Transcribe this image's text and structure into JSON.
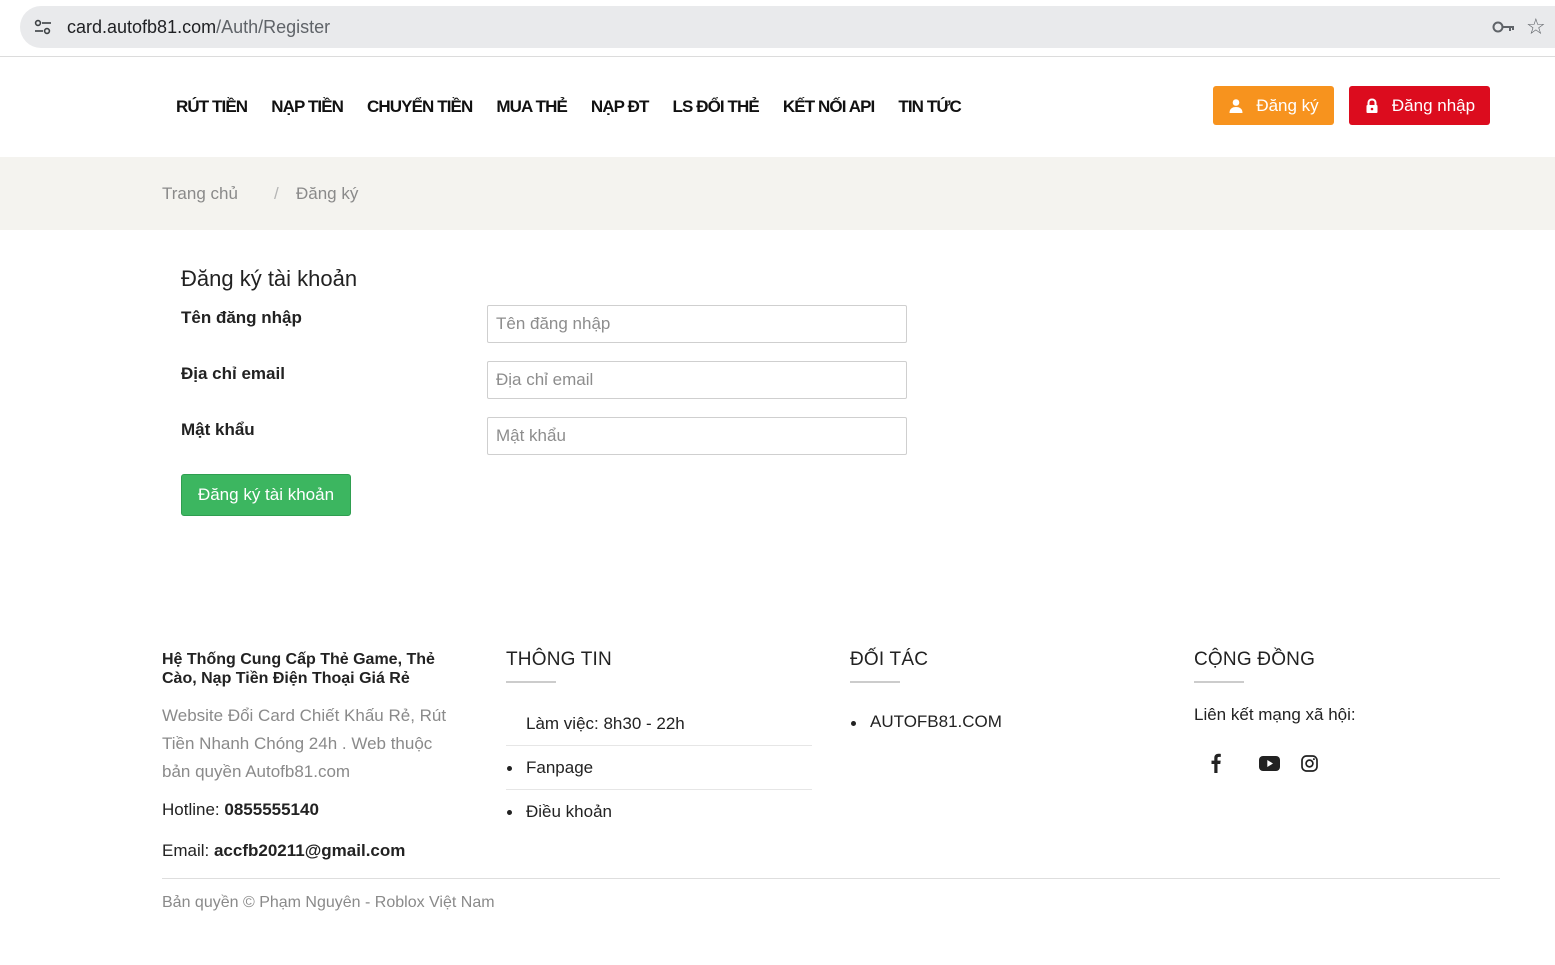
{
  "browser": {
    "url_host": "card.autofb81.com",
    "url_path": "/Auth/Register",
    "site_info_icon": "tune-icon",
    "password_icon": "key-icon",
    "bookmark_icon": "star-icon"
  },
  "header": {
    "nav": [
      "RÚT TIỀN",
      "NẠP TIỀN",
      "CHUYỂN TIỀN",
      "MUA THẺ",
      "NẠP ĐT",
      "LS ĐỔI THẺ",
      "KẾT NỐI API",
      "TIN TỨC"
    ],
    "register_label": "Đăng ký",
    "login_label": "Đăng nhập",
    "register_color": "#f7931e",
    "login_color": "#dc0c1e"
  },
  "breadcrumb": {
    "home": "Trang chủ",
    "separator": "/",
    "current": "Đăng ký"
  },
  "form": {
    "title": "Đăng ký tài khoản",
    "username_label": "Tên đăng nhập",
    "username_placeholder": "Tên đăng nhập",
    "email_label": "Địa chỉ email",
    "email_placeholder": "Địa chỉ email",
    "password_label": "Mật khẩu",
    "password_placeholder": "Mật khẩu",
    "submit_label": "Đăng ký tài khoản",
    "submit_color": "#3cb660"
  },
  "footer": {
    "about": {
      "title": "Hệ Thống Cung Cấp Thẻ Game, Thẻ Cào, Nạp Tiền Điện Thoại Giá Rẻ",
      "description": "Website Đổi Card Chiết Khấu Rẻ, Rút Tiền Nhanh Chóng 24h . Web thuộc bản quyền Autofb81.com",
      "hotline_label": "Hotline: ",
      "hotline_value": "0855555140",
      "email_label": "Email: ",
      "email_value": "accfb20211@gmail.com"
    },
    "info": {
      "title": "THÔNG TIN",
      "items": [
        "Làm việc: 8h30 - 22h",
        "Fanpage",
        "Điều khoản"
      ]
    },
    "partners": {
      "title": "ĐỐI TÁC",
      "items": [
        "AUTOFB81.COM"
      ]
    },
    "community": {
      "title": "CỘNG ĐỒNG",
      "text": "Liên kết mạng xã hội:",
      "icons": [
        "facebook-icon",
        "youtube-icon",
        "instagram-icon"
      ]
    },
    "copyright": "Bản quyền © Phạm Nguyên - Roblox Việt Nam"
  }
}
